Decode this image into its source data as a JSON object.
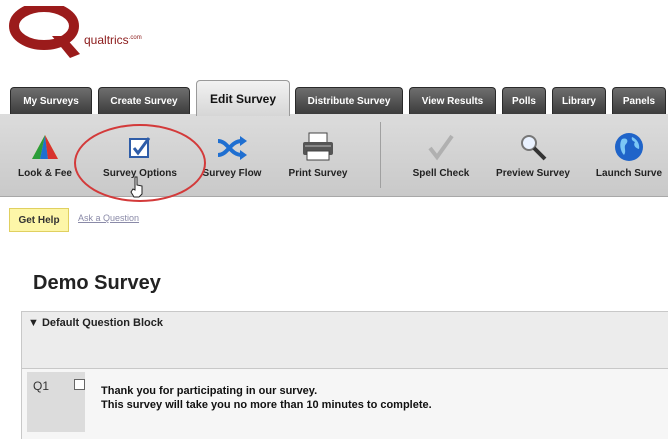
{
  "logo": {
    "brand": "qualtrics",
    "suffix": ".com",
    "mark": "Q"
  },
  "tabs": [
    {
      "label": "My Surveys"
    },
    {
      "label": "Create Survey"
    },
    {
      "label": "Edit Survey",
      "active": true
    },
    {
      "label": "Distribute Survey"
    },
    {
      "label": "View Results"
    },
    {
      "label": "Polls"
    },
    {
      "label": "Library"
    },
    {
      "label": "Panels"
    }
  ],
  "toolbar": {
    "items": [
      {
        "label": "Look & Fee",
        "icon": "look-feel-icon"
      },
      {
        "label": "Survey Options",
        "icon": "checkbox-icon",
        "highlighted": true
      },
      {
        "label": "Survey Flow",
        "icon": "flow-arrows-icon"
      },
      {
        "label": "Print Survey",
        "icon": "printer-icon"
      },
      {
        "label": "Spell Check",
        "icon": "checkmark-icon"
      },
      {
        "label": "Preview Survey",
        "icon": "magnifier-icon"
      },
      {
        "label": "Launch Surve",
        "icon": "globe-icon"
      }
    ]
  },
  "help": {
    "get_help": "Get Help",
    "ask": "Ask a Question"
  },
  "survey": {
    "title": "Demo Survey",
    "block_name": "▼ Default Question Block",
    "question": {
      "number": "Q1",
      "line1": "Thank you for participating in our survey.",
      "line2": "This survey will take you no more than 10 minutes to complete."
    }
  },
  "colors": {
    "accent_red": "#d33a3a",
    "logo_red": "#9b1b1b",
    "tab_dark": "#4a4a4a"
  }
}
